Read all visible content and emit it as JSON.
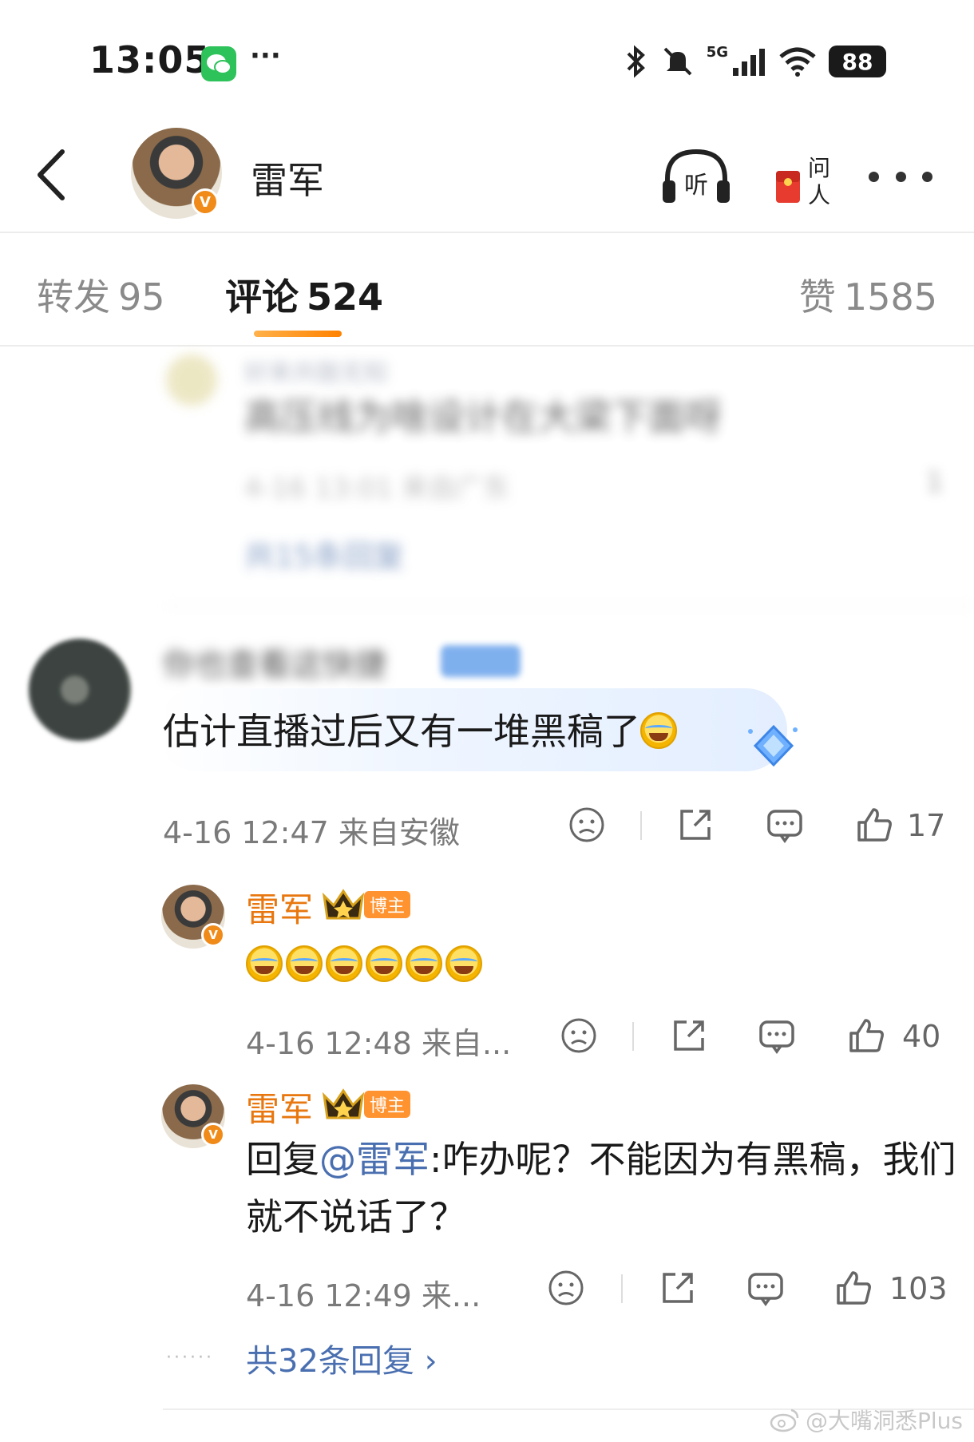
{
  "status_bar": {
    "time": "13:05",
    "network": "5G",
    "battery": "88"
  },
  "header": {
    "name": "雷军",
    "verified_badge": "V",
    "listen_label": "听",
    "ask_label": "问人"
  },
  "tabs": [
    {
      "label": "转发",
      "count": "95"
    },
    {
      "label": "评论",
      "count": "524"
    },
    {
      "label": "赞",
      "count": "1585"
    }
  ],
  "blurred_comment": {
    "name": "好来共鼓无知",
    "text": "高压线为啥设计在大梁下面呀",
    "meta": "4-16 13:01 来自广东",
    "likes": "1",
    "replies": "共15条回复"
  },
  "main_comment": {
    "text": "估计直播过后又有一堆黑稿了",
    "meta": "4-16 12:47  来自安徽",
    "likes": "17"
  },
  "replies": [
    {
      "name": "雷军",
      "tag": "博主",
      "emoji_count": 6,
      "meta": "4-16 12:48  来自...",
      "likes": "40"
    },
    {
      "name": "雷军",
      "tag": "博主",
      "prefix": "回复",
      "mention": "@雷军",
      "text": ":咋办呢？不能因为有黑稿，我们就不说话了？",
      "meta": "4-16 12:49  来...",
      "likes": "103"
    }
  ],
  "total_replies": "共32条回复 ›",
  "watermark": "@大嘴洞悉Plus",
  "colors": {
    "accent_orange": "#ff8200",
    "mention_blue": "#4a6fb0",
    "name_orange": "#e8770f"
  }
}
